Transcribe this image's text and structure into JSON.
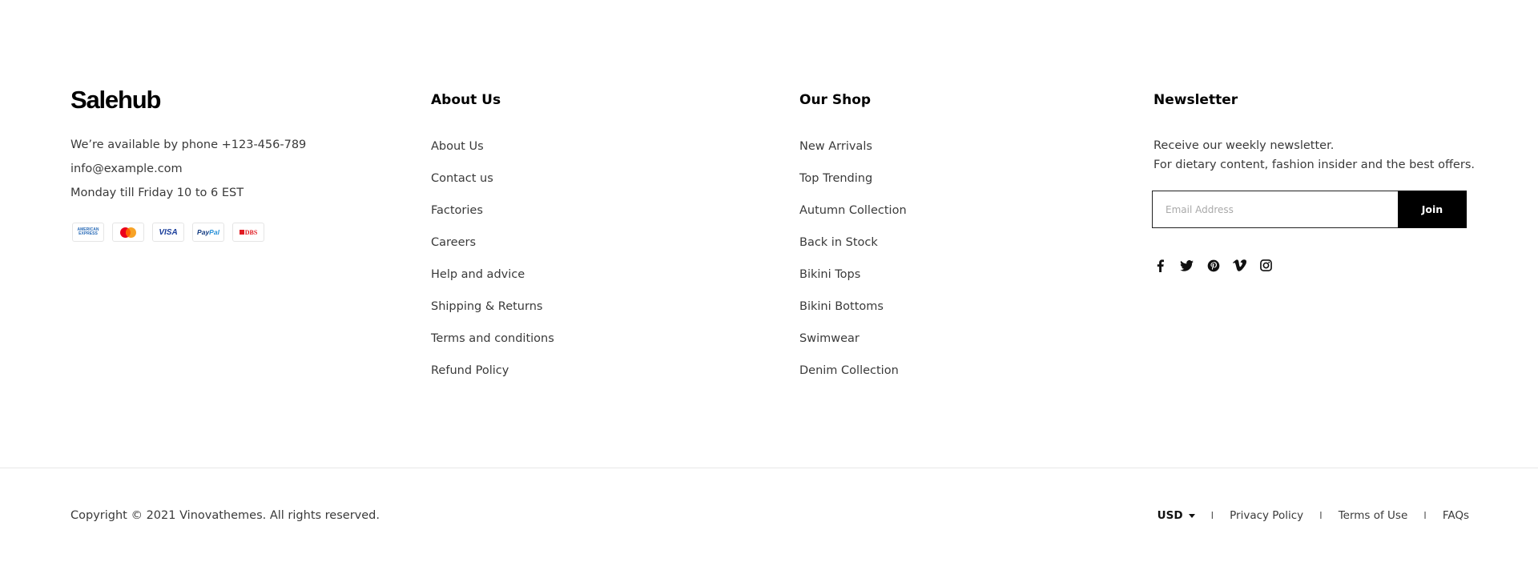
{
  "brand": {
    "logo_text": "Salehub"
  },
  "contact": {
    "phone_line": "We’re available by phone +123-456-789",
    "email": "info@example.com",
    "hours": "Monday till Friday 10 to 6 EST",
    "payment_methods": [
      {
        "name": "American Express",
        "label_top": "AMERICAN",
        "label_bottom": "EXPRESS"
      },
      {
        "name": "Mastercard"
      },
      {
        "name": "Visa",
        "label": "VISA"
      },
      {
        "name": "PayPal",
        "label_a": "Pay",
        "label_b": "Pal"
      },
      {
        "name": "DBS",
        "label": "DBS"
      }
    ]
  },
  "about": {
    "heading": "About Us",
    "links": [
      "About Us",
      "Contact us",
      "Factories",
      "Careers",
      "Help and advice",
      "Shipping & Returns",
      "Terms and conditions",
      "Refund Policy"
    ]
  },
  "shop": {
    "heading": "Our Shop",
    "links": [
      "New Arrivals",
      "Top Trending",
      "Autumn Collection",
      "Back in Stock",
      "Bikini Tops",
      "Bikini Bottoms",
      "Swimwear",
      "Denim Collection"
    ]
  },
  "newsletter": {
    "heading": "Newsletter",
    "line1": "Receive our weekly newsletter.",
    "line2": "For dietary content, fashion insider and the best offers.",
    "email_placeholder": "Email Address",
    "email_value": "",
    "join_label": "Join",
    "social_icons": [
      "facebook-icon",
      "twitter-icon",
      "pinterest-icon",
      "vimeo-icon",
      "instagram-icon"
    ]
  },
  "bottom": {
    "copyright": "Copyright © 2021 Vinovathemes. All rights reserved.",
    "currency": "USD",
    "separator": "I",
    "links": [
      "Privacy Policy",
      "Terms of Use",
      "FAQs"
    ]
  },
  "colors": {
    "background": "#ffffff",
    "text": "#3a3a3a",
    "heading": "#000000",
    "button_bg": "#000000",
    "button_text": "#ffffff",
    "divider": "#e8e8e8"
  }
}
